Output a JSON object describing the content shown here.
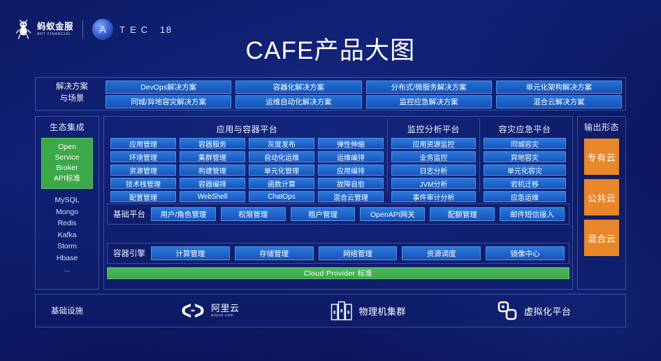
{
  "header": {
    "brand_cn": "蚂蚁金服",
    "brand_en": "ANT FINANCIAL",
    "event_letters": "TEC",
    "event_mark": "A",
    "event_number": "18"
  },
  "title": "CAFE产品大图",
  "colors": {
    "accent_blue": "#1f63c8",
    "green": "#3da849",
    "orange": "#e8872a",
    "background": "#0d1a66"
  },
  "solutions": {
    "label": "解决方案\n与场景",
    "label_line1": "解决方案",
    "label_line2": "与场景",
    "row1": [
      "DevOps解决方案",
      "容器化解决方案",
      "分布式/微服务解决方案",
      "单元化架构解决方案"
    ],
    "row2": [
      "同城/异地容灾解决方案",
      "运维自动化解决方案",
      "监控应急解决方案",
      "混合云解决方案"
    ]
  },
  "ecosystem": {
    "title": "生态集成",
    "standard": [
      "Open",
      "Service",
      "Broker",
      "API标准"
    ],
    "components": [
      "MySQL",
      "Mongo",
      "Redis",
      "Kafka",
      "Storm",
      "Hbase",
      "..."
    ]
  },
  "platforms": [
    {
      "title": "应用与容器平台",
      "columns": [
        [
          "应用管理",
          "环境管理",
          "资源管理",
          "技术栈管理",
          "配置管理"
        ],
        [
          "容器服务",
          "集群管理",
          "构建管理",
          "容器编排",
          "WebShell"
        ],
        [
          "灰度发布",
          "自动化运维",
          "单元化管理",
          "函数计算",
          "ChatOps"
        ],
        [
          "弹性伸缩",
          "运维编排",
          "应用编排",
          "故障自愈",
          "混合云管理"
        ]
      ]
    },
    {
      "title": "监控分析平台",
      "columns": [
        [
          "应用资源监控",
          "业务监控",
          "日志分析",
          "JVM分析",
          "事件审计分析"
        ]
      ]
    },
    {
      "title": "容灾应急平台",
      "columns": [
        [
          "同城容灾",
          "异地容灾",
          "单元化容灾",
          "宕机迁移",
          "应急运维"
        ]
      ]
    }
  ],
  "base_platform": {
    "label": "基础平台",
    "items": [
      "用户/角色管理",
      "权限管理",
      "租户管理",
      "OpenAPI网关",
      "配额管理",
      "邮件短信接入"
    ]
  },
  "container_engine": {
    "label": "容器引擎",
    "items": [
      "计算管理",
      "存储管理",
      "网络管理",
      "资源调度",
      "镜像中心"
    ]
  },
  "cloud_provider_bar": "Cloud Provider 标准",
  "output": {
    "title": "输出形态",
    "items": [
      "专有云",
      "公共云",
      "混合云"
    ]
  },
  "infrastructure": {
    "label": "基础设施",
    "items": [
      {
        "name": "阿里云",
        "sub": "aliyun.com",
        "icon": "aliyun-icon"
      },
      {
        "name": "物理机集群",
        "sub": "",
        "icon": "server-rack-icon"
      },
      {
        "name": "虚拟化平台",
        "sub": "",
        "icon": "vmware-icon"
      }
    ]
  }
}
